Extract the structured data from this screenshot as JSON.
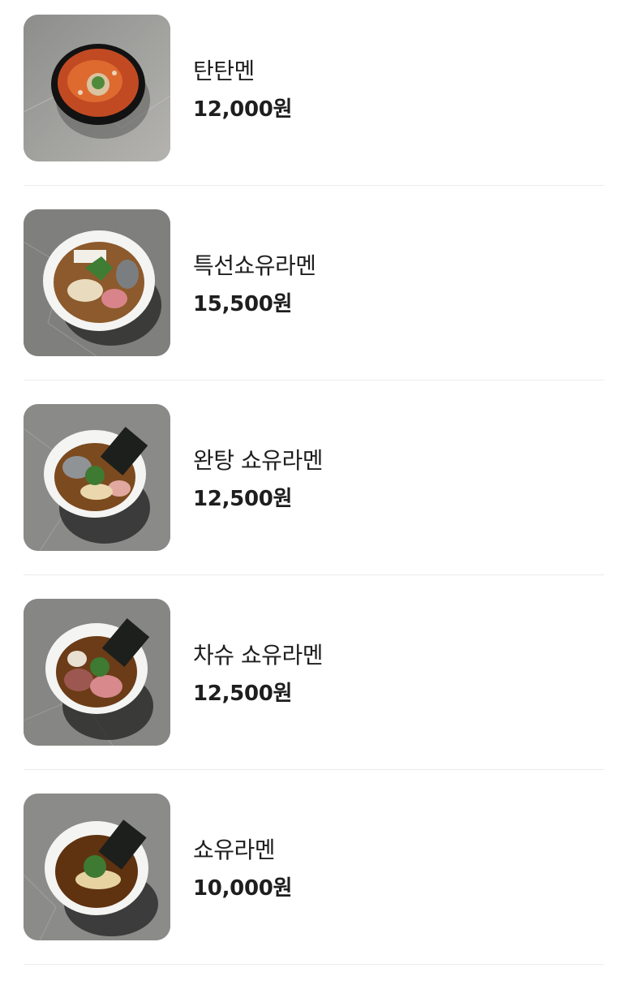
{
  "menu": {
    "items": [
      {
        "name": "탄탄멘",
        "price": "12,000원",
        "image": "tantanmen-photo"
      },
      {
        "name": "특선쇼유라멘",
        "price": "15,500원",
        "image": "special-shoyu-ramen-photo"
      },
      {
        "name": "완탕 쇼유라멘",
        "price": "12,500원",
        "image": "wonton-shoyu-ramen-photo"
      },
      {
        "name": "차슈 쇼유라멘",
        "price": "12,500원",
        "image": "chashu-shoyu-ramen-photo"
      },
      {
        "name": "쇼유라멘",
        "price": "10,000원",
        "image": "shoyu-ramen-photo"
      }
    ]
  }
}
